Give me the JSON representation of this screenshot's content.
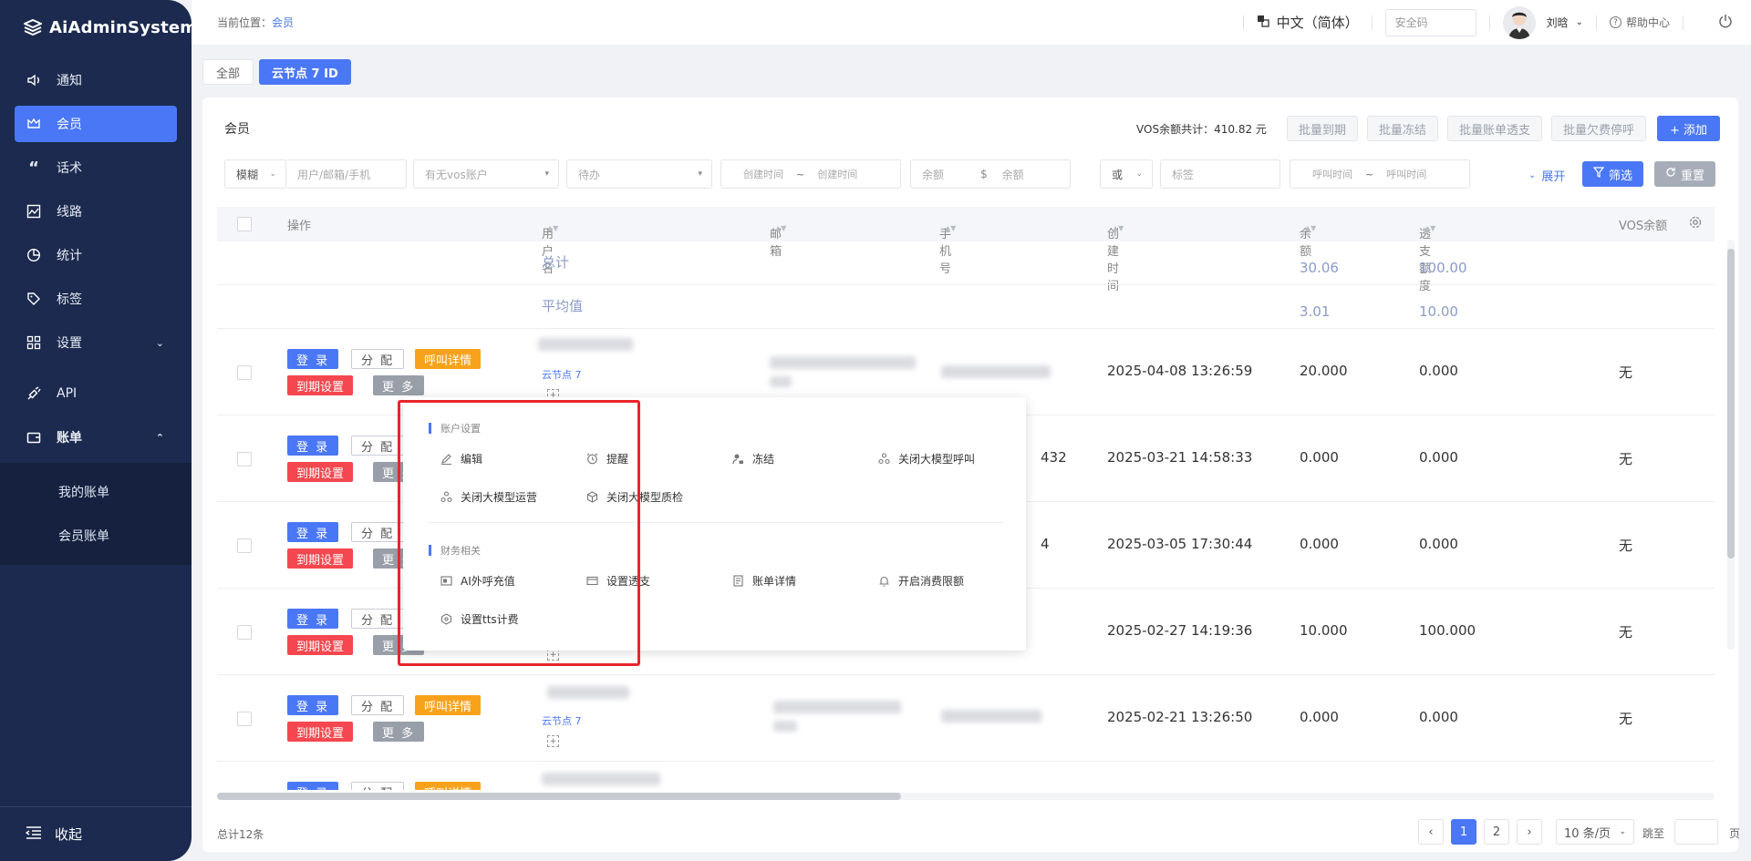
{
  "app": {
    "logo": "AiAdminSystem"
  },
  "sidebar": {
    "items": [
      {
        "label": "通知",
        "icon": "speaker-icon"
      },
      {
        "label": "会员",
        "icon": "crown-icon",
        "active": true
      },
      {
        "label": "话术",
        "icon": "quote-icon"
      },
      {
        "label": "线路",
        "icon": "route-icon"
      },
      {
        "label": "统计",
        "icon": "pie-chart-icon"
      },
      {
        "label": "标签",
        "icon": "tag-icon"
      },
      {
        "label": "设置",
        "icon": "grid-icon",
        "chevron": "down"
      },
      {
        "label": "API",
        "icon": "plug-icon"
      },
      {
        "label": "账单",
        "icon": "wallet-icon",
        "chevron": "up"
      }
    ],
    "sub_items": [
      "我的账单",
      "会员账单"
    ],
    "collapse_label": "收起"
  },
  "topbar": {
    "crumb_prefix": "当前位置：",
    "crumb_current": "会员",
    "language": "中文（简体）",
    "security_placeholder": "安全码",
    "username": "刘晗",
    "help": "帮助中心"
  },
  "tabs": {
    "all": "全部",
    "node": "云节点 7  ID"
  },
  "card": {
    "title": "会员",
    "vos_total_label": "VOS余额共计：",
    "vos_total_value": "410.82 元",
    "bulk_buttons": [
      "批量到期",
      "批量冻结",
      "批量账单透支",
      "批量欠费停呼"
    ],
    "add_button": "+ 添加"
  },
  "filters": {
    "match_mode": "模糊",
    "user_placeholder": "用户/邮箱/手机",
    "vos_account": "有无vos账户",
    "pending": "待办",
    "created_from": "创建时间",
    "created_to": "创建时间",
    "range_sep": "~",
    "balance_from": "余额",
    "currency": "$",
    "balance_to": "余额",
    "logic": "或",
    "tag_placeholder": "标签",
    "call_from": "呼叫时间",
    "call_to": "呼叫时间",
    "expand": "展开",
    "filter_button": "筛选",
    "reset_button": "重置"
  },
  "table": {
    "headers": {
      "ops": "操作",
      "username": "用户名",
      "email": "邮箱",
      "phone": "手机号",
      "created": "创建时间",
      "balance": "余额",
      "overdraft": "透支额度",
      "vos": "VOS余额"
    },
    "summary": [
      {
        "label": "总计",
        "balance": "30.06",
        "overdraft": "100.00"
      },
      {
        "label": "平均值",
        "balance": "3.01",
        "overdraft": "10.00"
      }
    ],
    "row_buttons": {
      "login": "登 录",
      "assign": "分 配",
      "call_detail": "呼叫详情",
      "expire": "到期设置",
      "more": "更 多"
    },
    "rows": [
      {
        "node": "云节点 7",
        "phone_tail": "",
        "created": "2025-04-08 13:26:59",
        "balance": "20.000",
        "overdraft": "0.000",
        "vos": "无"
      },
      {
        "node": "",
        "phone_tail": "432",
        "created": "2025-03-21 14:58:33",
        "balance": "0.000",
        "overdraft": "0.000",
        "vos": "无"
      },
      {
        "node": "",
        "phone_tail": "4",
        "created": "2025-03-05 17:30:44",
        "balance": "0.000",
        "overdraft": "0.000",
        "vos": "无"
      },
      {
        "node": "",
        "phone_tail": "",
        "created": "2025-02-27 14:19:36",
        "balance": "10.000",
        "overdraft": "100.000",
        "vos": "无"
      },
      {
        "node": "云节点 7",
        "phone_tail": "",
        "created": "2025-02-21 13:26:50",
        "balance": "0.000",
        "overdraft": "0.000",
        "vos": "无"
      }
    ]
  },
  "popup": {
    "section1": "账户设置",
    "items1": [
      {
        "label": "编辑",
        "icon": "pencil-icon"
      },
      {
        "label": "提醒",
        "icon": "alarm-clock-icon"
      },
      {
        "label": "冻结",
        "icon": "user-lock-icon"
      },
      {
        "label": "关闭大模型呼叫",
        "icon": "model-icon"
      },
      {
        "label": "关闭大模型运营",
        "icon": "model-icon"
      },
      {
        "label": "关闭大模型质检",
        "icon": "cube-icon"
      }
    ],
    "section2": "财务相关",
    "items2": [
      {
        "label": "AI外呼充值",
        "icon": "recharge-icon"
      },
      {
        "label": "设置透支",
        "icon": "card-icon"
      },
      {
        "label": "账单详情",
        "icon": "bill-icon"
      },
      {
        "label": "开启消费限额",
        "icon": "bell-icon"
      },
      {
        "label": "设置tts计费",
        "icon": "hexagon-icon"
      }
    ]
  },
  "footer": {
    "total": "总计12条",
    "pages": [
      "1",
      "2"
    ],
    "page_size": "10 条/页",
    "jump_label": "跳至",
    "page_suffix": "页"
  }
}
